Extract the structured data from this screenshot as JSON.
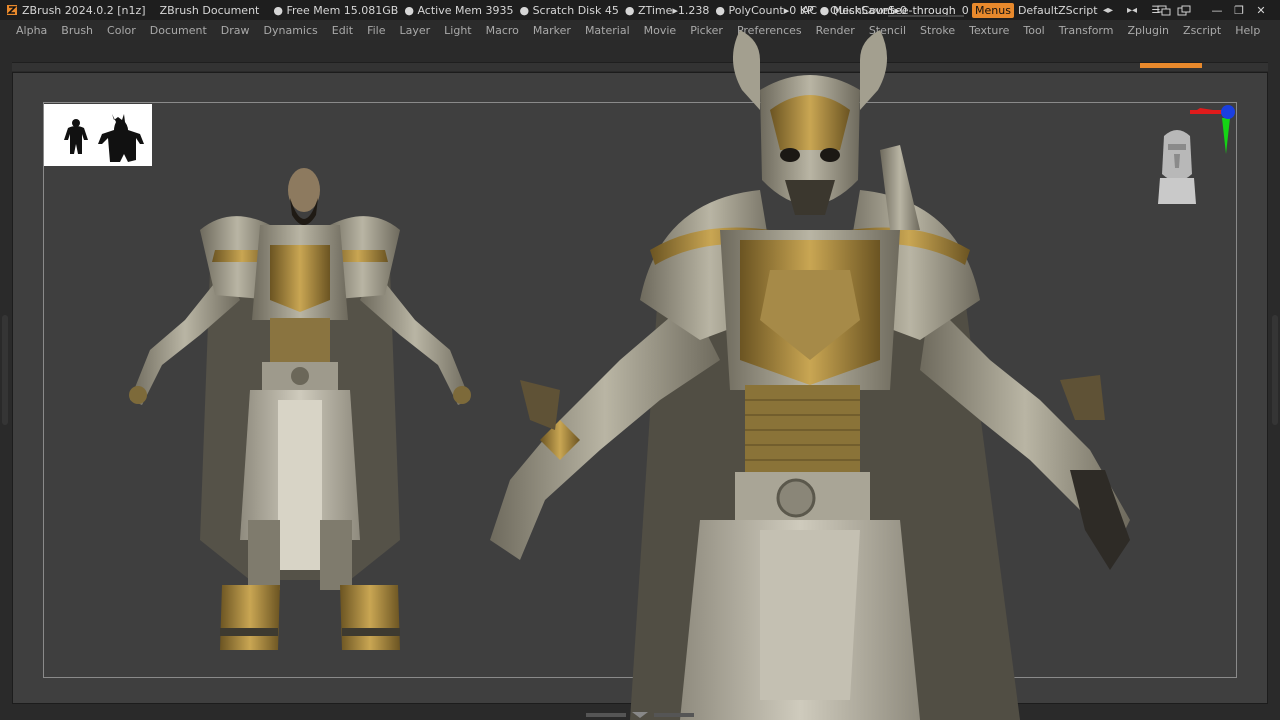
{
  "title_bar": {
    "app": "ZBrush 2024.0.2 [n1z]",
    "document": "ZBrush Document",
    "stats": [
      {
        "label": "Free Mem",
        "value": "15.081GB"
      },
      {
        "label": "Active Mem",
        "value": "3935"
      },
      {
        "label": "Scratch Disk",
        "value": "45"
      },
      {
        "label": "ZTime▸",
        "value": "1.238"
      },
      {
        "label": "PolyCount▸",
        "value": "0 KP"
      },
      {
        "label": "MeshCount▸",
        "value": "0"
      }
    ],
    "ac_label": "AC",
    "quicksave_label": "QuickSave",
    "see_through_label": "See-through",
    "see_through_value": 0,
    "see_through_display": "0",
    "menus_label": "Menus",
    "script_label": "DefaultZScript",
    "accent_color": "#e8892c"
  },
  "menu_bar": {
    "items": [
      "Alpha",
      "Brush",
      "Color",
      "Document",
      "Draw",
      "Dynamics",
      "Edit",
      "File",
      "Layer",
      "Light",
      "Macro",
      "Marker",
      "Material",
      "Movie",
      "Picker",
      "Preferences",
      "Render",
      "Stencil",
      "Stroke",
      "Texture",
      "Tool",
      "Transform",
      "Zplugin",
      "Zscript",
      "Help"
    ]
  },
  "icons": {
    "toolbar": [
      "collapse-left-icon",
      "expand-icon",
      "menu-double-icon",
      "restore-layout-icon",
      "swap-layout-icon"
    ],
    "window": [
      "minimize-icon",
      "restore-icon",
      "close-icon"
    ]
  }
}
